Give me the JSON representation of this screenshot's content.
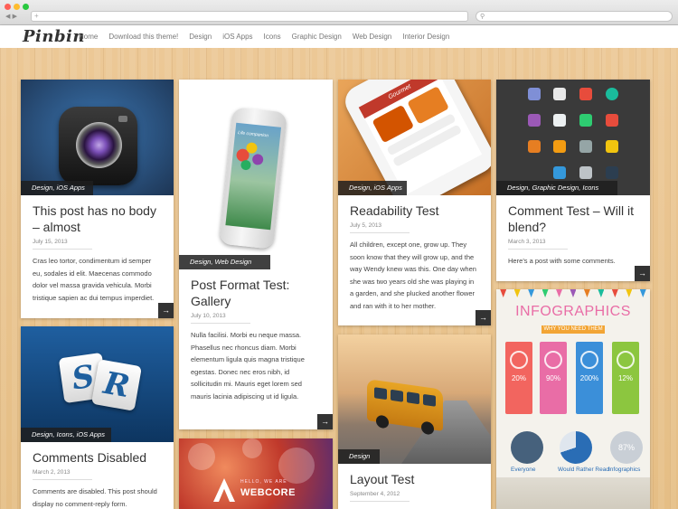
{
  "browser": {
    "url_placeholder": "+",
    "search_placeholder": "⚲",
    "nav_back": "◀ ▶"
  },
  "site": {
    "logo": "Pinbin",
    "nav": [
      "Home",
      "Download this theme!",
      "Design",
      "iOS Apps",
      "Icons",
      "Graphic Design",
      "Web Design",
      "Interior Design"
    ]
  },
  "posts": [
    {
      "id": "post-no-body",
      "categories": "Design, iOS Apps",
      "title": "This post has no body – almost",
      "date": "July 15, 2013",
      "excerpt": "Cras leo tortor, condimentum id semper eu, sodales id elit. Maecenas commodo dolor vel massa gravida vehicula. Morbi tristique sapien ac dui tempus imperdiet.",
      "more": "→"
    },
    {
      "id": "post-format-gallery",
      "categories": "Design, Web Design",
      "title": "Post Format Test: Gallery",
      "date": "July 10, 2013",
      "excerpt": "Nulla facilisi. Morbi eu neque massa. Phasellus nec rhoncus diam. Morbi elementum ligula quis magna tristique egestas. Donec nec eros nibh, id sollicitudin mi. Mauris eget lorem sed mauris lacinia adipiscing ut id ligula.",
      "more": "→",
      "thumb_text": "Life companion"
    },
    {
      "id": "post-readability",
      "categories": "Design, iOS Apps",
      "title": "Readability Test",
      "date": "July 5, 2013",
      "excerpt": "All children, except one, grow up. They soon know that they will grow up, and the way Wendy knew was this. One day when she was two years old she was playing in a garden, and she plucked another flower and ran with it to her mother.",
      "more": "→",
      "thumb_text": "Gourmet"
    },
    {
      "id": "post-comment-test",
      "categories": "Design, Graphic Design, Icons",
      "title": "Comment Test – Will it blend?",
      "date": "March 3, 2013",
      "excerpt": "Here’s a post with some comments.",
      "more": "→"
    },
    {
      "id": "post-comments-disabled",
      "categories": "Design, Icons, iOS Apps",
      "title": "Comments Disabled",
      "date": "March 2, 2013",
      "excerpt": "Comments are disabled. This post should display no comment-reply form.",
      "thumb_text_1": "S",
      "thumb_text_2": "R"
    },
    {
      "id": "post-layout-test",
      "categories": "Design",
      "title": "Layout Test",
      "date": "September 4, 2012"
    },
    {
      "id": "post-webcore",
      "thumb_sub": "HELLO, WE ARE",
      "thumb_text": "WEBCORE"
    },
    {
      "id": "post-infographics",
      "thumb_title": "INFOGRAPHICS",
      "thumb_sub": "WHY YOU NEED THEM",
      "stats": [
        "20%",
        "90%",
        "200%",
        "12%"
      ],
      "labels": [
        "Everyone",
        "Would Rather Read",
        "Infographics"
      ],
      "pie_value": "87%"
    }
  ],
  "colors": {
    "wood": "#e9c894",
    "card_overlay": "#1e1e1e",
    "infographic_pink": "#e96da6"
  }
}
